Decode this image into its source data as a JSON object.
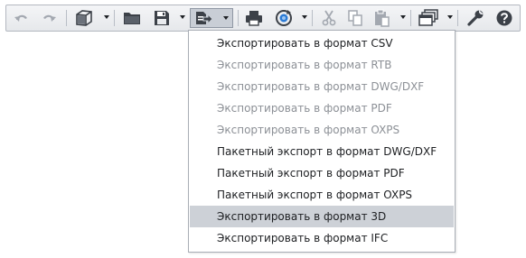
{
  "toolbar": {
    "buttons": [
      {
        "icon": "undo-icon",
        "enabled": false
      },
      {
        "icon": "redo-icon",
        "enabled": false
      },
      {
        "icon": "3d-box-icon",
        "has_dropdown": true
      },
      {
        "icon": "open-folder-icon"
      },
      {
        "icon": "save-icon",
        "has_dropdown": true
      },
      {
        "icon": "export-icon",
        "has_dropdown": true,
        "active": true
      },
      {
        "icon": "print-icon"
      },
      {
        "icon": "rotate-view-icon",
        "has_dropdown": true
      },
      {
        "icon": "cut-icon",
        "enabled": false
      },
      {
        "icon": "copy-icon",
        "enabled": false
      },
      {
        "icon": "paste-icon",
        "has_dropdown": true,
        "enabled": false
      },
      {
        "icon": "windows-icon",
        "has_dropdown": true
      },
      {
        "icon": "wrench-icon"
      },
      {
        "icon": "help-icon"
      }
    ],
    "colors": {
      "icon": "#3c4148",
      "disabled_icon": "#a3a8b0",
      "blue": "#2b7bd6"
    }
  },
  "export_menu": {
    "items": [
      {
        "label": "Экспортировать в формат CSV",
        "enabled": true
      },
      {
        "label": "Экспортировать в формат RTB",
        "enabled": false
      },
      {
        "label": "Экспортировать в формат DWG/DXF",
        "enabled": false
      },
      {
        "label": "Экспортировать в формат PDF",
        "enabled": false
      },
      {
        "label": "Экспортировать в формат OXPS",
        "enabled": false
      },
      {
        "label": "Пакетный экспорт в формат DWG/DXF",
        "enabled": true
      },
      {
        "label": "Пакетный экспорт в формат PDF",
        "enabled": true
      },
      {
        "label": "Пакетный экспорт в формат OXPS",
        "enabled": true
      },
      {
        "label": "Экспортировать в формат 3D",
        "enabled": true,
        "highlighted": true
      },
      {
        "label": "Экспортировать в формат IFC",
        "enabled": true
      }
    ],
    "highlight_color": "#cdd1d7"
  }
}
